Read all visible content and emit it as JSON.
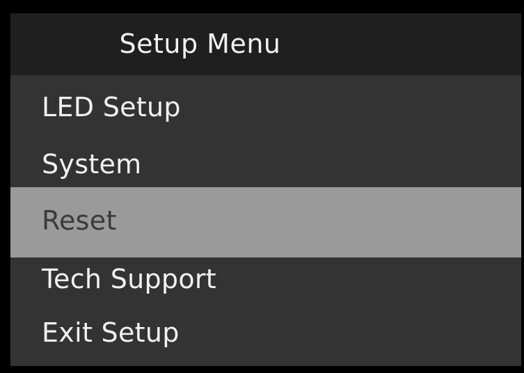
{
  "colors": {
    "frame": "#000000",
    "header_background": "#1f1f1f",
    "panel_background": "#333333",
    "selected_background": "#9a9a9a",
    "text": "#f2f2f2",
    "selected_text": "#3a3a3a"
  },
  "menu": {
    "title": "Setup Menu",
    "selected_index": 2,
    "items": [
      {
        "label": "LED Setup"
      },
      {
        "label": "System"
      },
      {
        "label": "Reset"
      },
      {
        "label": "Tech Support"
      },
      {
        "label": "Exit Setup"
      }
    ]
  }
}
